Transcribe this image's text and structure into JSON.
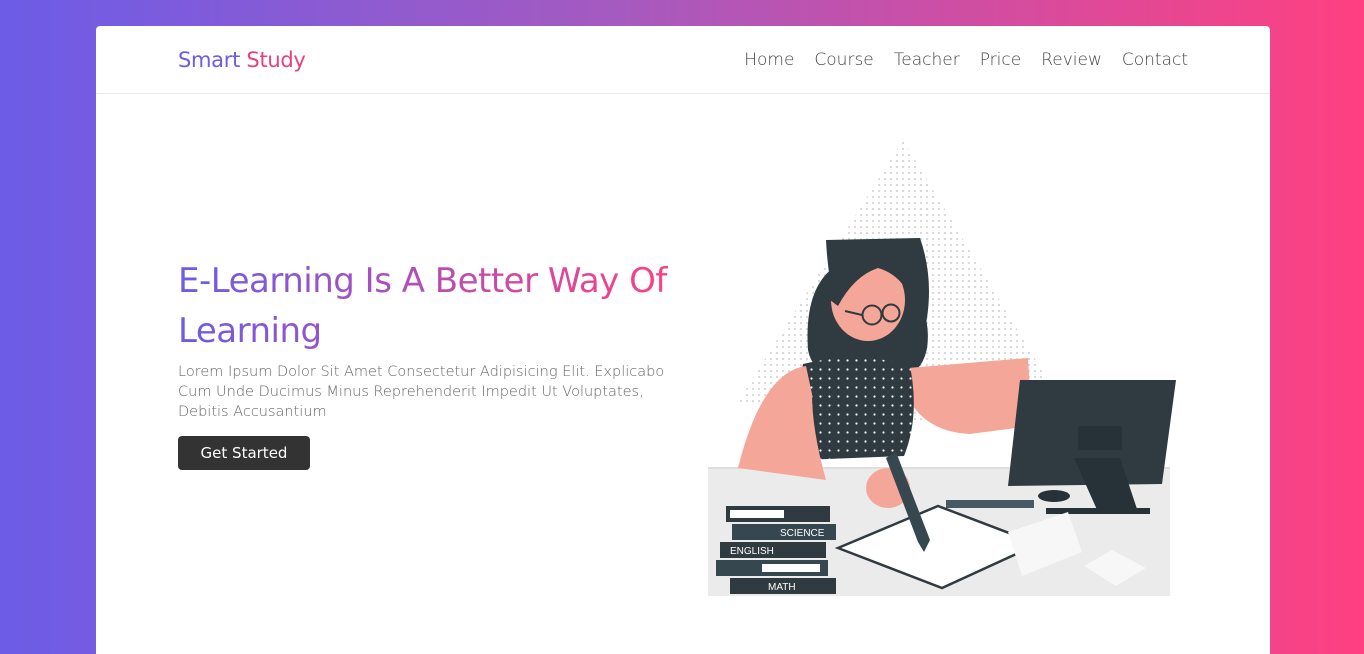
{
  "brand": {
    "part1": "Smart",
    "part2": "Study"
  },
  "nav": {
    "items": [
      "Home",
      "Course",
      "Teacher",
      "Price",
      "Review",
      "Contact"
    ]
  },
  "hero": {
    "title": "E-Learning Is A Better Way Of Learning",
    "description": "Lorem Ipsum Dolor Sit Amet Consectetur Adipisicing Elit. Explicabo Cum Unde Ducimus Minus Reprehenderit Impedit Ut Voluptates, Debitis Accusantium",
    "cta_label": "Get Started"
  },
  "illustration": {
    "books": [
      "SCIENCE",
      "ENGLISH",
      "MATH"
    ]
  },
  "colors": {
    "brand_primary": "#6c5ce7",
    "brand_secondary": "#e8407b",
    "button_bg": "#333333"
  }
}
